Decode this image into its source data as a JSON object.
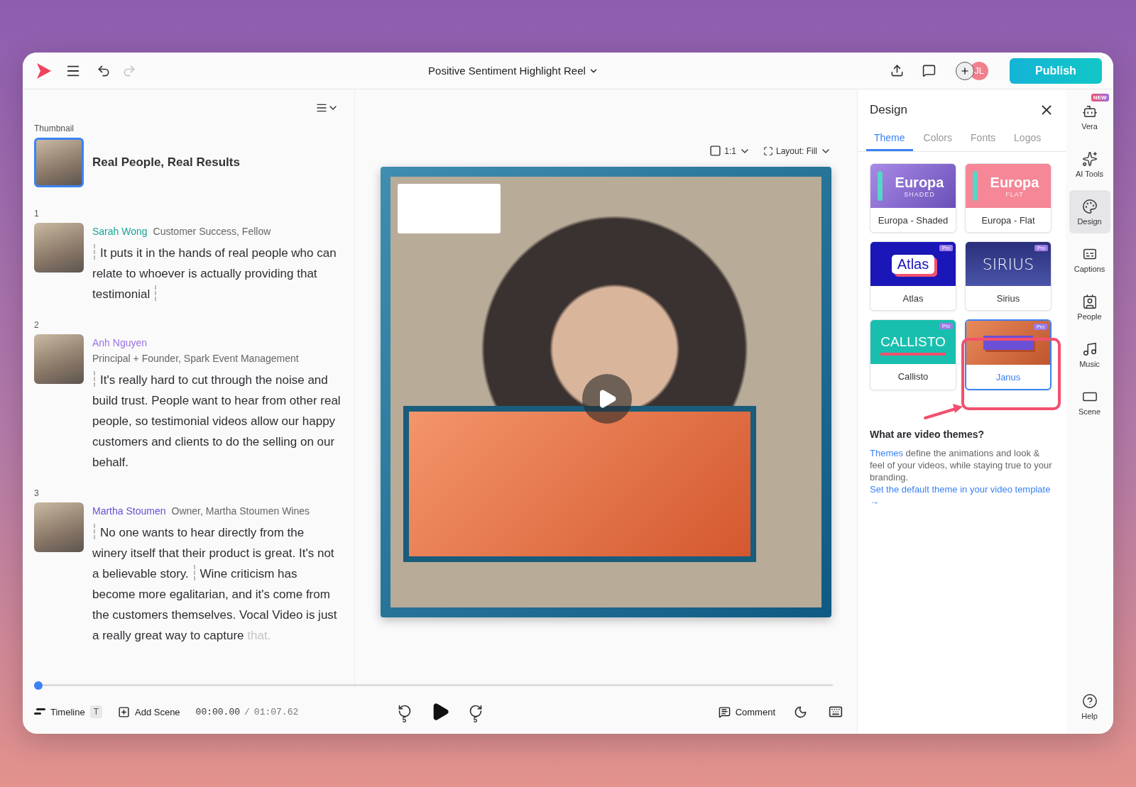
{
  "topbar": {
    "title": "Positive Sentiment Highlight Reel",
    "undo_disabled": false,
    "redo_disabled": true,
    "avatar": "JL",
    "publish": "Publish"
  },
  "script": {
    "thumbnail_label": "Thumbnail",
    "thumbnail_title": "Real People, Real Results",
    "thumbnail_selected": true,
    "scenes": [
      {
        "number": "1",
        "name": "Sarah Wong",
        "color": "#17a596",
        "role": "Customer Success, Fellow",
        "role_below": false,
        "segments": [
          "It puts it in the hands of real people who can relate to whoever is actually providing that testimonial"
        ],
        "end_marker": true
      },
      {
        "number": "2",
        "name": "Anh Nguyen",
        "color": "#9a72e6",
        "role": "Principal + Founder, Spark Event Management",
        "role_below": true,
        "segments": [
          "It's really hard to cut through the noise and build trust. People want to hear from other real people, so testimonial videos allow our happy customers and clients to do the selling on our behalf."
        ]
      },
      {
        "number": "3",
        "name": "Martha Stoumen",
        "color": "#6a4fd6",
        "role": "Owner, Martha Stoumen Wines",
        "role_below": false,
        "segments": [
          "No one wants to hear directly from the winery itself that their product is great. It's not a believable story.",
          "Wine criticism has become more egalitarian, and it's come from the customers themselves. Vocal Video is just a really great way to capture"
        ],
        "faded_tail": "that."
      }
    ]
  },
  "canvas": {
    "aspect": "1:1",
    "layout": "Layout: Fill"
  },
  "player": {
    "level": 0,
    "timeline": "Timeline",
    "timeline_key": "T",
    "add_scene": "Add Scene",
    "current_time": "00:00.00",
    "time_separator": "/",
    "total_time": "01:07.62",
    "rewind_label": "5",
    "forward_label": "5",
    "comment": "Comment"
  },
  "design": {
    "title": "Design",
    "tabs": [
      {
        "label": "Theme",
        "selected": true
      },
      {
        "label": "Colors",
        "selected": false
      },
      {
        "label": "Fonts",
        "selected": false
      },
      {
        "label": "Logos",
        "selected": false
      }
    ],
    "themes": [
      {
        "kind": "europa-shaded",
        "thumb_title": "Europa",
        "thumb_sub": "SHADED",
        "name": "Europa - Shaded",
        "selected": false
      },
      {
        "kind": "europa-flat",
        "thumb_title": "Europa",
        "thumb_sub": "FLAT",
        "name": "Europa - Flat",
        "selected": false
      },
      {
        "kind": "atlas",
        "thumb_title": "Atlas",
        "name": "Atlas",
        "pro": "Pro",
        "selected": false
      },
      {
        "kind": "sirius",
        "thumb_title": "SIRIUS",
        "name": "Sirius",
        "pro": "Pro",
        "selected": false
      },
      {
        "kind": "callisto",
        "thumb_title": "CALLISTO",
        "name": "Callisto",
        "pro": "Pro",
        "selected": false
      },
      {
        "kind": "janus",
        "name": "Janus",
        "pro": "Pro",
        "selected": true
      }
    ],
    "help_title": "What are video themes?",
    "help_link": "Themes",
    "help_text": "define the animations and look & feel of your videos, while staying true to your branding.",
    "help_cta": "Set the default theme in your video template →"
  },
  "rail": {
    "items": [
      {
        "kind": "vera",
        "label": "Vera",
        "badge": "NEW",
        "selected": false
      },
      {
        "kind": "ai",
        "label": "AI Tools",
        "selected": false
      },
      {
        "kind": "design",
        "label": "Design",
        "selected": true
      },
      {
        "kind": "captions",
        "label": "Captions",
        "selected": false
      },
      {
        "kind": "people",
        "label": "People",
        "selected": false
      },
      {
        "kind": "music",
        "label": "Music",
        "selected": false
      },
      {
        "kind": "scene",
        "label": "Scene",
        "selected": false
      }
    ],
    "help": "Help"
  }
}
